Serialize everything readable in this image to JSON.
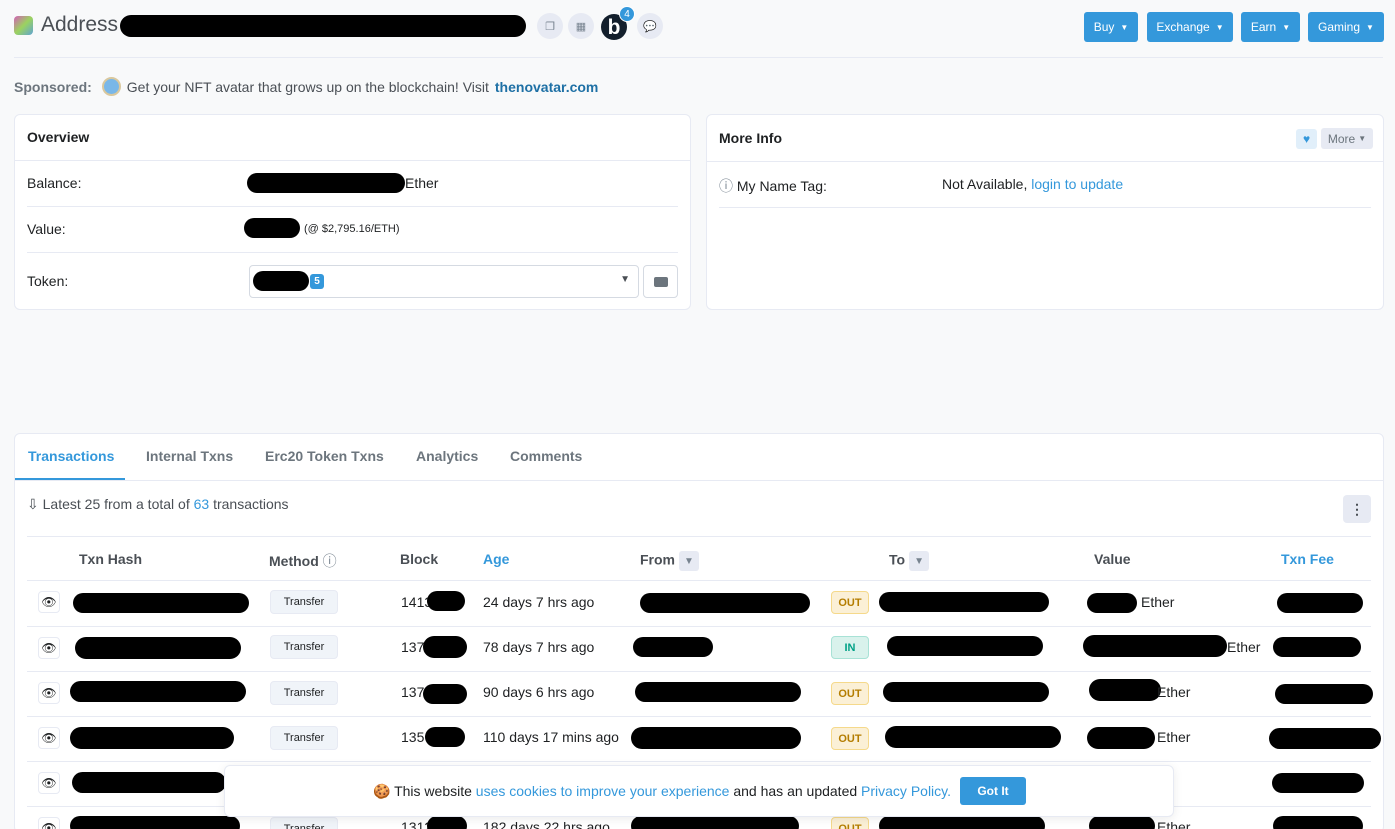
{
  "header": {
    "title": "Address",
    "badge_count": "4",
    "buttons": [
      {
        "label": "Buy"
      },
      {
        "label": "Exchange"
      },
      {
        "label": "Earn"
      },
      {
        "label": "Gaming"
      }
    ]
  },
  "sponsored": {
    "label": "Sponsored:",
    "text": "Get your NFT avatar that grows up on the blockchain! Visit",
    "link": "thenovatar.com"
  },
  "overview": {
    "title": "Overview",
    "balance_label": "Balance:",
    "balance_unit": "Ether",
    "value_label": "Value:",
    "value_rate": "(@ $2,795.16/ETH)",
    "token_label": "Token:",
    "token_count": "5"
  },
  "more_info": {
    "title": "More Info",
    "more_label": "More",
    "name_tag_label": "My Name Tag:",
    "name_tag_value": "Not Available,",
    "name_tag_link": "login to update"
  },
  "tabs": [
    {
      "label": "Transactions"
    },
    {
      "label": "Internal Txns"
    },
    {
      "label": "Erc20 Token Txns"
    },
    {
      "label": "Analytics"
    },
    {
      "label": "Comments"
    }
  ],
  "summary": {
    "prefix": "Latest 25 from a total of",
    "count": "63",
    "suffix": "transactions"
  },
  "table": {
    "headers": [
      "Txn Hash",
      "Method",
      "Block",
      "Age",
      "From",
      "To",
      "Value",
      "Txn Fee"
    ],
    "rows": [
      {
        "method": "Transfer",
        "block": "1413",
        "age": "24 days 7 hrs ago",
        "dir": "OUT",
        "unit": "Ether"
      },
      {
        "method": "Transfer",
        "block": "137",
        "age": "78 days 7 hrs ago",
        "dir": "IN",
        "unit": "Ether"
      },
      {
        "method": "Transfer",
        "block": "137",
        "age": "90 days 6 hrs ago",
        "dir": "OUT",
        "unit": "Ether"
      },
      {
        "method": "Transfer",
        "block": "135",
        "age": "110 days 17 mins ago",
        "dir": "OUT",
        "unit": "Ether"
      },
      {
        "method": "",
        "block": "",
        "age": "",
        "dir": "",
        "unit": ""
      },
      {
        "method": "Transfer",
        "block": "1312",
        "age": "182 days 22 hrs ago",
        "dir": "OUT",
        "unit": "Ether"
      }
    ]
  },
  "cookie": {
    "prefix": "This website",
    "link1": "uses cookies to improve your experience",
    "middle": "and has an updated",
    "link2": "Privacy Policy.",
    "button": "Got It"
  }
}
